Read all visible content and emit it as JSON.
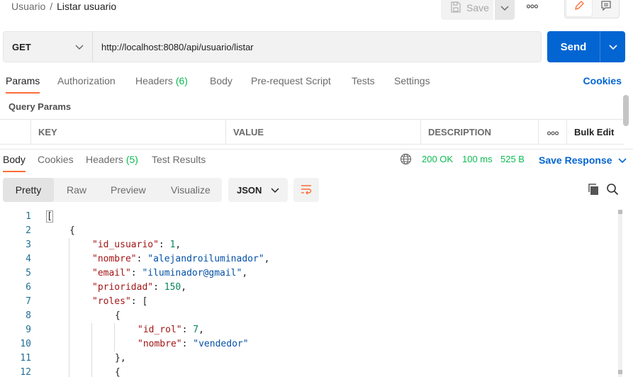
{
  "breadcrumb": {
    "parent": "Usuario",
    "separator": "/",
    "current": "Listar usuario"
  },
  "toolbar": {
    "save_label": "Save"
  },
  "request": {
    "method": "GET",
    "url": "http://localhost:8080/api/usuario/listar",
    "send_label": "Send"
  },
  "request_tabs": {
    "params": "Params",
    "authorization": "Authorization",
    "headers": "Headers",
    "headers_count": "(6)",
    "body": "Body",
    "pre_request": "Pre-request Script",
    "tests": "Tests",
    "settings": "Settings",
    "cookies": "Cookies"
  },
  "query_params": {
    "title": "Query Params",
    "columns": {
      "key": "KEY",
      "value": "VALUE",
      "description": "DESCRIPTION",
      "more": "ooo",
      "bulk_edit": "Bulk Edit"
    }
  },
  "response_tabs": {
    "body": "Body",
    "cookies": "Cookies",
    "headers": "Headers",
    "headers_count": "(5)",
    "test_results": "Test Results"
  },
  "response_status": {
    "status": "200 OK",
    "time": "100 ms",
    "size": "525 B",
    "save_response": "Save Response"
  },
  "response_view": {
    "modes": {
      "pretty": "Pretty",
      "raw": "Raw",
      "preview": "Preview",
      "visualize": "Visualize"
    },
    "format": "JSON"
  },
  "code_lines": [
    {
      "n": "1",
      "t": [
        [
          "p",
          "["
        ]
      ]
    },
    {
      "n": "2",
      "t": [
        [
          "p",
          "{"
        ]
      ]
    },
    {
      "n": "3",
      "t": [
        [
          "k",
          "\"id_usuario\""
        ],
        [
          "p",
          ": "
        ],
        [
          "n",
          "1"
        ],
        [
          "p",
          ","
        ]
      ]
    },
    {
      "n": "4",
      "t": [
        [
          "k",
          "\"nombre\""
        ],
        [
          "p",
          ": "
        ],
        [
          "s",
          "\"alejandroiluminador\""
        ],
        [
          "p",
          ","
        ]
      ]
    },
    {
      "n": "5",
      "t": [
        [
          "k",
          "\"email\""
        ],
        [
          "p",
          ": "
        ],
        [
          "s",
          "\"iluminador@gmail\""
        ],
        [
          "p",
          ","
        ]
      ]
    },
    {
      "n": "6",
      "t": [
        [
          "k",
          "\"prioridad\""
        ],
        [
          "p",
          ": "
        ],
        [
          "n",
          "150"
        ],
        [
          "p",
          ","
        ]
      ]
    },
    {
      "n": "7",
      "t": [
        [
          "k",
          "\"roles\""
        ],
        [
          "p",
          ": ["
        ]
      ]
    },
    {
      "n": "8",
      "t": [
        [
          "p",
          "{"
        ]
      ]
    },
    {
      "n": "9",
      "t": [
        [
          "k",
          "\"id_rol\""
        ],
        [
          "p",
          ": "
        ],
        [
          "n",
          "7"
        ],
        [
          "p",
          ","
        ]
      ]
    },
    {
      "n": "10",
      "t": [
        [
          "k",
          "\"nombre\""
        ],
        [
          "p",
          ": "
        ],
        [
          "s",
          "\"vendedor\""
        ]
      ]
    },
    {
      "n": "11",
      "t": [
        [
          "p",
          "},"
        ]
      ]
    },
    {
      "n": "12",
      "t": [
        [
          "p",
          "{"
        ]
      ]
    }
  ],
  "icons": {
    "save": "save-icon",
    "chevron": "chevron-down-icon",
    "more": "more-horizontal-icon",
    "edit": "pencil-icon",
    "comments": "comment-icon",
    "globe": "globe-icon",
    "wrap": "wrap-lines-icon",
    "copy": "copy-icon",
    "search": "search-icon"
  },
  "colors": {
    "accent": "#ff6c37",
    "primary": "#0265d2",
    "success": "#0cbb52"
  }
}
